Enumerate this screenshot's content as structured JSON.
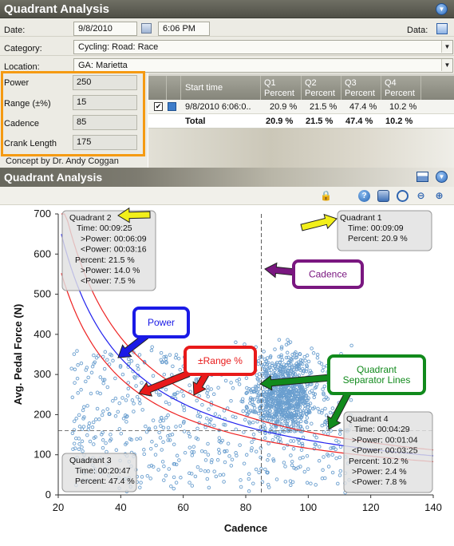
{
  "window": {
    "title": "Quadrant Analysis"
  },
  "form": {
    "date_label": "Date:",
    "date_value": "9/8/2010",
    "time_value": "6:06 PM",
    "data_label": "Data:",
    "category_label": "Category:",
    "category_value": "Cycling: Road: Race",
    "location_label": "Location:",
    "location_value": "GA: Marietta"
  },
  "params": {
    "power_label": "Power",
    "power_value": "250",
    "range_label": "Range (±%)",
    "range_value": "15",
    "cadence_label": "Cadence",
    "cadence_value": "85",
    "crank_label": "Crank Length",
    "crank_value": "175",
    "concept": "Concept by Dr. Andy Coggan"
  },
  "grid": {
    "start_time_header": "Start time",
    "q1_header": "Q1",
    "q2_header": "Q2",
    "q3_header": "Q3",
    "q4_header": "Q4",
    "percent_header": "Percent",
    "row_start": "9/8/2010 6:06:0..",
    "row_q1": "20.9 %",
    "row_q2": "21.5 %",
    "row_q3": "47.4 %",
    "row_q4": "10.2 %",
    "total_label": "Total",
    "total_q1": "20.9 %",
    "total_q2": "21.5 %",
    "total_q3": "47.4 %",
    "total_q4": "10.2 %",
    "row_checked": true,
    "row_color": "#3d7cc9"
  },
  "panel": {
    "title": "Quadrant Analysis"
  },
  "chart_data": {
    "type": "scatter",
    "xlabel": "Cadence",
    "ylabel": "Avg. Pedal Force (N)",
    "xlim": [
      20,
      140
    ],
    "ylim": [
      0,
      700
    ],
    "xticks": [
      "20",
      "40",
      "60",
      "80",
      "100",
      "120",
      "140"
    ],
    "yticks": [
      "0",
      "100",
      "200",
      "300",
      "400",
      "500",
      "600",
      "700"
    ],
    "cadence_separator": 85,
    "force_separator": 160,
    "power_watts": 250,
    "range_pct": 15,
    "crank_length_mm": 175,
    "point_color": "#6b9fcf",
    "power_curve_color": "#2222ee",
    "range_curve_color": "#ee2222",
    "quadrants": [
      {
        "name": "Quadrant 1",
        "lines": [
          "Quadrant 1",
          "Time: 00:09:09",
          "Percent: 20.9 %"
        ]
      },
      {
        "name": "Quadrant 2",
        "lines": [
          "Quadrant 2",
          "Time: 00:09:25",
          ">Power: 00:06:09",
          "<Power: 00:03:16",
          "Percent: 21.5 %",
          ">Power: 14.0 %",
          "<Power: 7.5 %"
        ]
      },
      {
        "name": "Quadrant 3",
        "lines": [
          "Quadrant 3",
          "Time: 00:20:47",
          "Percent: 47.4 %"
        ]
      },
      {
        "name": "Quadrant 4",
        "lines": [
          "Quadrant 4",
          "Time: 00:04:29",
          ">Power: 00:01:04",
          "<Power: 00:03:25",
          "Percent: 10.2 %",
          ">Power: 2.4 %",
          "<Power: 7.8 %"
        ]
      }
    ],
    "callouts": [
      {
        "label": "Cadence",
        "color": "#7a1780"
      },
      {
        "label": "Power",
        "color": "#1a1ae6"
      },
      {
        "label": "±Range %",
        "color": "#e81a1a"
      },
      {
        "label": "Quadrant Separator Lines",
        "color": "#118a1c"
      }
    ]
  }
}
